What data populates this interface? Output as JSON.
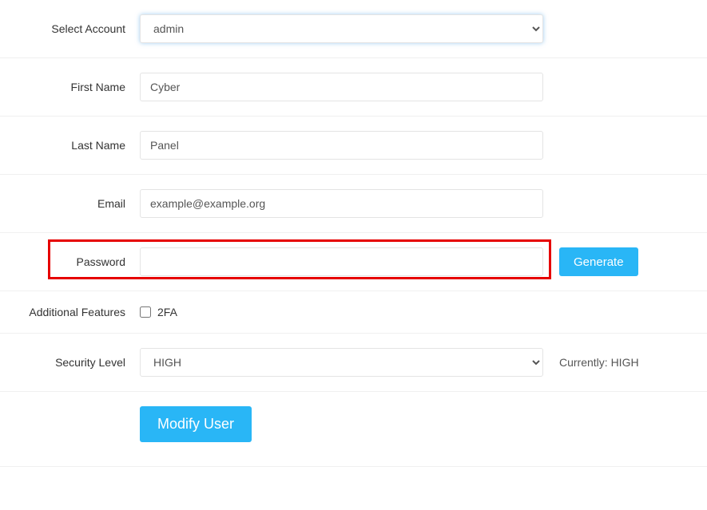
{
  "form": {
    "selectAccount": {
      "label": "Select Account",
      "value": "admin"
    },
    "firstName": {
      "label": "First Name",
      "value": "Cyber"
    },
    "lastName": {
      "label": "Last Name",
      "value": "Panel"
    },
    "email": {
      "label": "Email",
      "value": "example@example.org"
    },
    "password": {
      "label": "Password",
      "value": "",
      "generateButton": "Generate"
    },
    "additionalFeatures": {
      "label": "Additional Features",
      "twoFA": "2FA"
    },
    "securityLevel": {
      "label": "Security Level",
      "value": "HIGH",
      "currently": "Currently: HIGH"
    },
    "submit": {
      "label": "Modify User"
    }
  }
}
